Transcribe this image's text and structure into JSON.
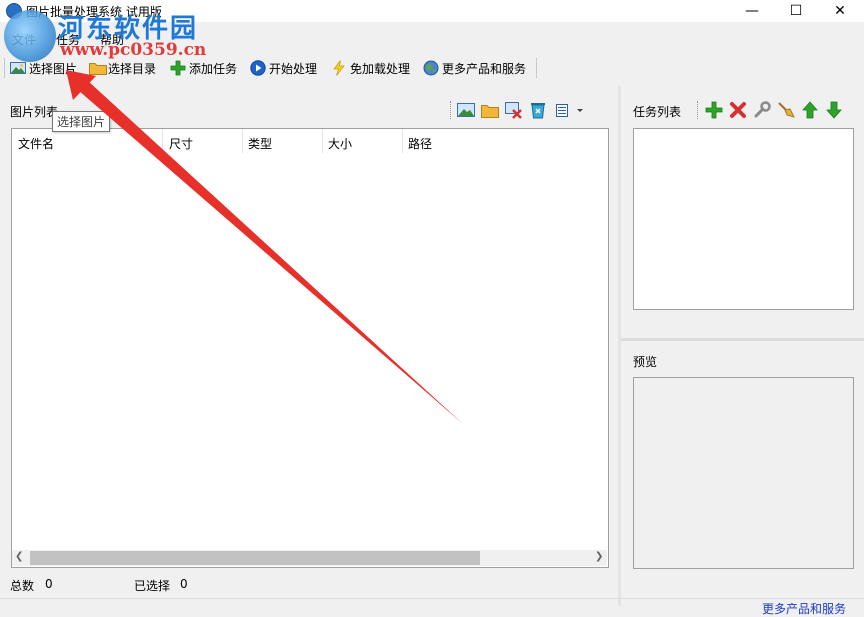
{
  "window": {
    "title": "图片批量处理系统 试用版",
    "controls": {
      "minimize": "—",
      "maximize": "☐",
      "close": "✕"
    }
  },
  "watermark": {
    "text": "河东软件园",
    "url": "www.pc0359.cn"
  },
  "menu": [
    "文件",
    "任务",
    "帮助"
  ],
  "toolbar": [
    {
      "label": "选择图片",
      "icon": "picture-icon"
    },
    {
      "label": "选择目录",
      "icon": "folder-icon"
    },
    {
      "label": "添加任务",
      "icon": "plus-icon"
    },
    {
      "label": "开始处理",
      "icon": "play-icon"
    },
    {
      "label": "免加载处理",
      "icon": "lightning-icon"
    },
    {
      "label": "更多产品和服务",
      "icon": "globe-icon"
    }
  ],
  "image_panel": {
    "label": "图片列表",
    "columns": [
      "文件名",
      "尺寸",
      "类型",
      "大小",
      "路径"
    ]
  },
  "tooltip": "选择图片",
  "status": {
    "total_label": "总数",
    "total_value": "0",
    "selected_label": "已选择",
    "selected_value": "0"
  },
  "task_panel": {
    "label": "任务列表"
  },
  "preview_panel": {
    "label": "预览"
  },
  "bottom_link": "更多产品和服务",
  "colors": {
    "annotation_arrow": "#e8302a",
    "link": "#1a3cc8",
    "add": "#2aa52a",
    "delete": "#d83030"
  }
}
